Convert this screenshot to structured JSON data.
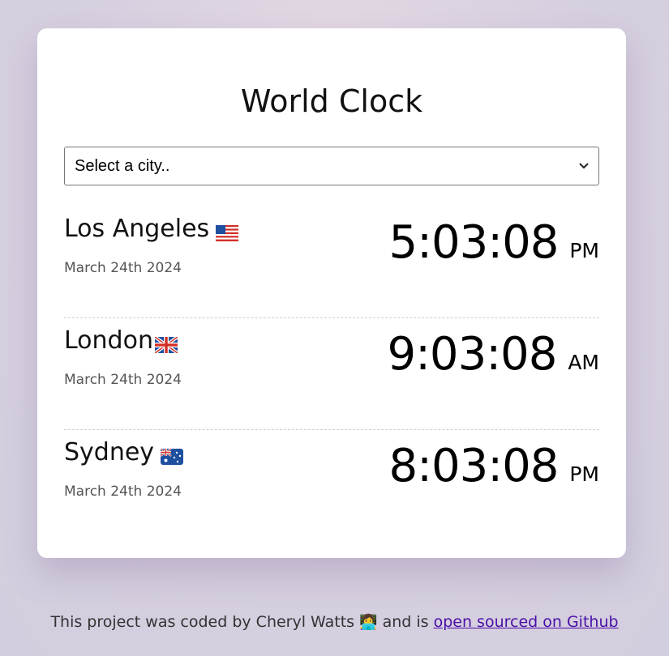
{
  "app": {
    "title": "World Clock"
  },
  "select": {
    "selected_label": "Select a city.."
  },
  "cities": [
    {
      "name": "Los Angeles",
      "flag_icon": "us-flag-icon",
      "date": "March 24th 2024",
      "time": "5:03:08",
      "ampm": "PM"
    },
    {
      "name": "London",
      "flag_icon": "uk-flag-icon",
      "date": "March 24th 2024",
      "time": "9:03:08",
      "ampm": "AM"
    },
    {
      "name": "Sydney",
      "flag_icon": "australia-flag-icon",
      "date": "March 24th 2024",
      "time": "8:03:08",
      "ampm": "PM"
    }
  ],
  "footer": {
    "text_before": "This project was coded by Cheryl Watts",
    "emoji": "👩‍💻",
    "text_middle": "and is",
    "link_text": "open sourced on Github"
  },
  "colors": {
    "background": "#d9d1de",
    "card": "#ffffff",
    "link": "#4b0fa8"
  }
}
